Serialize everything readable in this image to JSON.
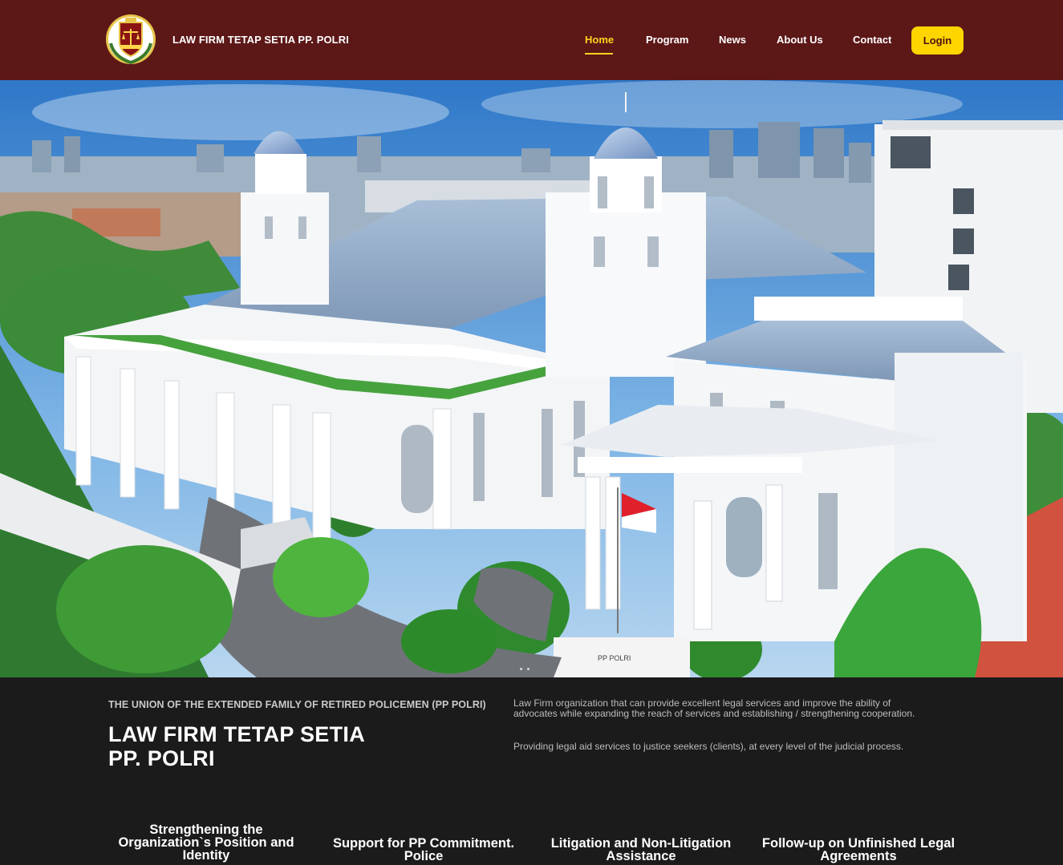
{
  "header": {
    "brand": "LAW FIRM TETAP SETIA PP. POLRI",
    "nav": [
      {
        "label": "Home",
        "active": true
      },
      {
        "label": "Program"
      },
      {
        "label": "News"
      },
      {
        "label": "About Us"
      },
      {
        "label": "Contact"
      }
    ],
    "login_label": "Login"
  },
  "hero": {
    "sign_text": "PP POLRI"
  },
  "info": {
    "eyebrow": "THE UNION OF THE EXTENDED FAMILY OF RETIRED POLICEMEN (PP POLRI)",
    "title_line1": "LAW FIRM TETAP SETIA",
    "title_line2": "PP. POLRI",
    "description_1": "Law Firm organization that can provide excellent legal services and improve the ability of advocates while expanding the reach of services and establishing / strengthening cooperation.",
    "description_2": "Providing legal aid services to justice seekers (clients), at every level of the judicial process."
  },
  "features": [
    "Strengthening the Organization`s Position and Identity",
    "Support for PP Commitment. Police",
    "Litigation and Non-Litigation Assistance",
    "Follow-up on Unfinished Legal Agreements"
  ],
  "colors": {
    "header_bg": "#5c1717",
    "accent": "#ffd500",
    "section_bg": "#1b1b1b"
  },
  "icons": [
    "law-firm-logo-icon"
  ]
}
